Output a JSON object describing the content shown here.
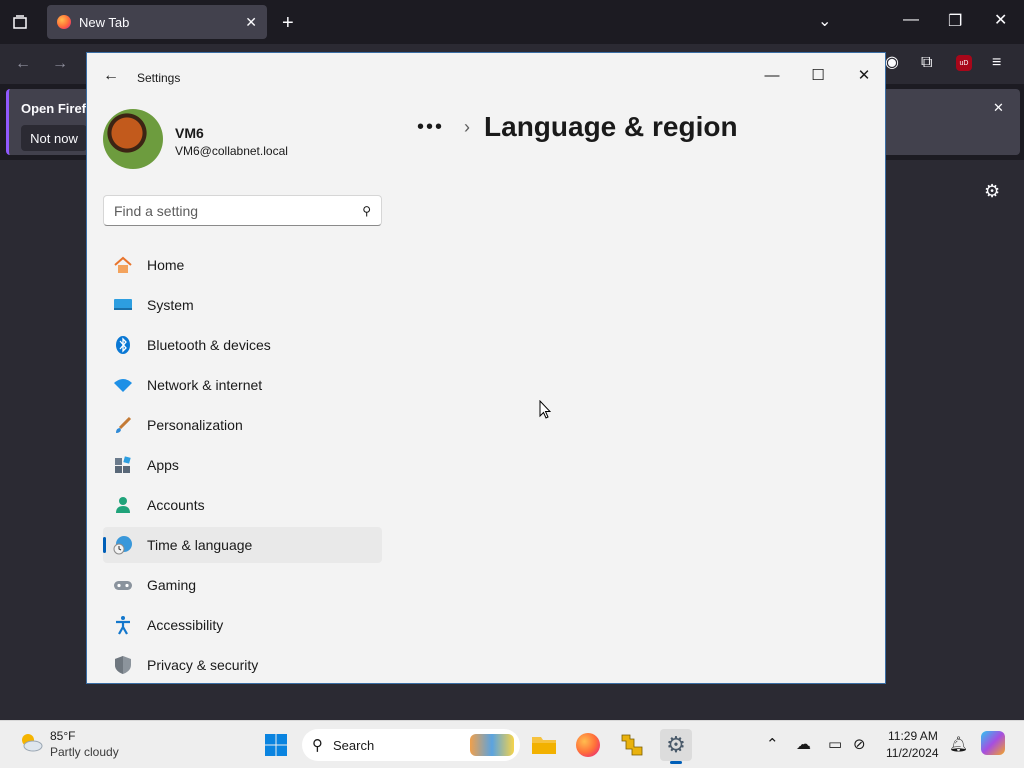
{
  "browser": {
    "tab_title": "New Tab",
    "notification_title": "Open Firefo",
    "notification_button": "Not now"
  },
  "settings": {
    "window_title": "Settings",
    "user": {
      "name": "VM6",
      "email": "VM6@collabnet.local"
    },
    "search_placeholder": "Find a setting",
    "nav": [
      {
        "label": "Home",
        "icon": "home-icon"
      },
      {
        "label": "System",
        "icon": "system-icon"
      },
      {
        "label": "Bluetooth & devices",
        "icon": "bluetooth-icon"
      },
      {
        "label": "Network & internet",
        "icon": "wifi-icon"
      },
      {
        "label": "Personalization",
        "icon": "brush-icon"
      },
      {
        "label": "Apps",
        "icon": "apps-icon"
      },
      {
        "label": "Accounts",
        "icon": "account-icon"
      },
      {
        "label": "Time & language",
        "icon": "globe-clock-icon",
        "selected": true
      },
      {
        "label": "Gaming",
        "icon": "gamepad-icon"
      },
      {
        "label": "Accessibility",
        "icon": "accessibility-icon"
      },
      {
        "label": "Privacy & security",
        "icon": "shield-icon"
      }
    ],
    "breadcrumb_overflow": "•••",
    "page_title": "Language & region",
    "accent_color": "#005fb8"
  },
  "taskbar": {
    "weather_temp": "85°F",
    "weather_desc": "Partly cloudy",
    "search_label": "Search",
    "time": "11:29 AM",
    "date": "11/2/2024"
  }
}
